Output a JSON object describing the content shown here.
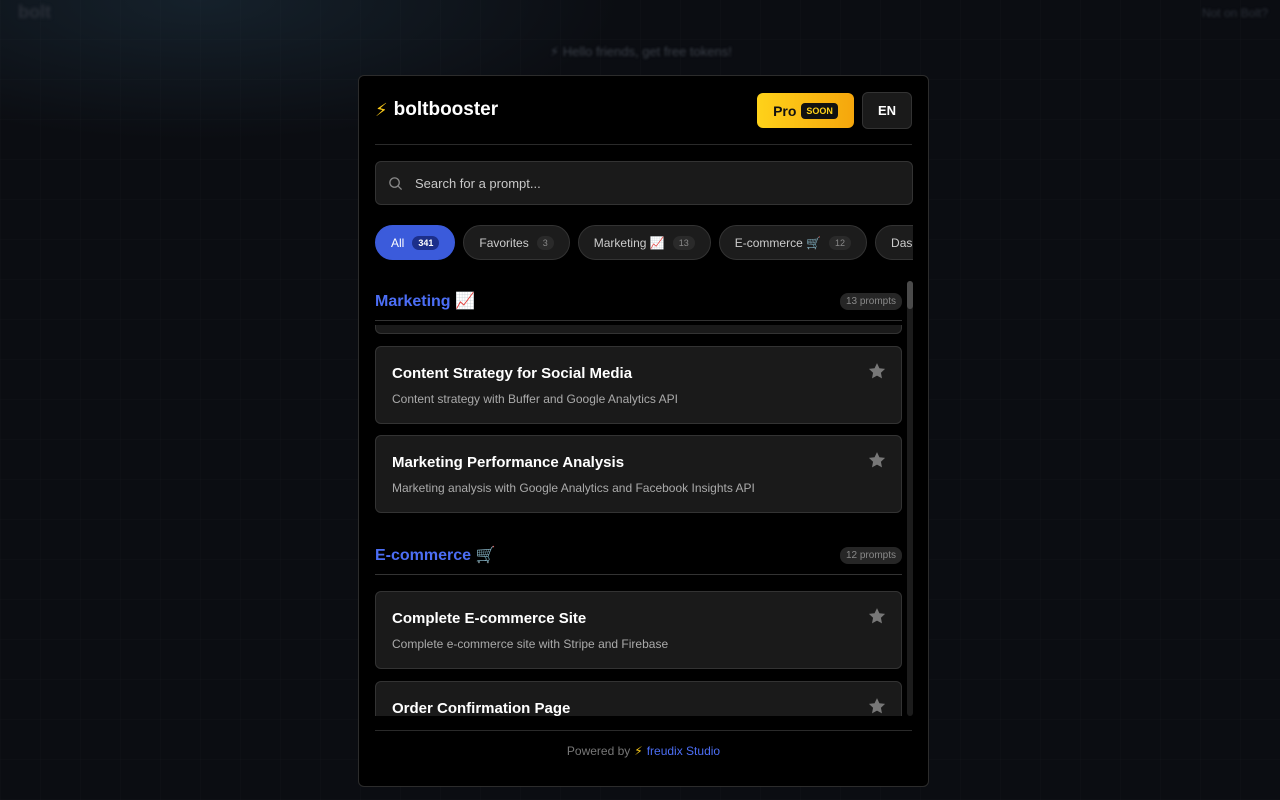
{
  "background": {
    "logo": "bolt",
    "banner": "⚡ Hello friends, get free tokens!",
    "top_right": "Not on Bolt?"
  },
  "header": {
    "brand": "boltbooster",
    "brand_icon": "⚡",
    "pro_label": "Pro",
    "soon_label": "SOON",
    "lang_label": "EN"
  },
  "search": {
    "placeholder": "Search for a prompt..."
  },
  "filters": [
    {
      "label": "All",
      "count": "341",
      "active": true
    },
    {
      "label": "Favorites",
      "count": "3"
    },
    {
      "label": "Marketing 📈",
      "count": "13"
    },
    {
      "label": "E-commerce 🛒",
      "count": "12"
    },
    {
      "label": "Dashboards",
      "count": ""
    }
  ],
  "sections": [
    {
      "title": "Marketing 📈",
      "count": "13 prompts",
      "cards": [
        {
          "title": "Content Strategy for Social Media",
          "desc": "Content strategy with Buffer and Google Analytics API"
        },
        {
          "title": "Marketing Performance Analysis",
          "desc": "Marketing analysis with Google Analytics and Facebook Insights API"
        }
      ]
    },
    {
      "title": "E-commerce 🛒",
      "count": "12 prompts",
      "cards": [
        {
          "title": "Complete E-commerce Site",
          "desc": "Complete e-commerce site with Stripe and Firebase"
        },
        {
          "title": "Order Confirmation Page",
          "desc": ""
        }
      ]
    }
  ],
  "footer": {
    "prefix": "Powered by",
    "bolt": "⚡",
    "link": "freudix Studio"
  },
  "colors": {
    "accent": "#4c6ef5",
    "pro_gradient_start": "#ffd21a",
    "pro_gradient_end": "#f5a60c",
    "chip_active": "#3b5bdb"
  }
}
